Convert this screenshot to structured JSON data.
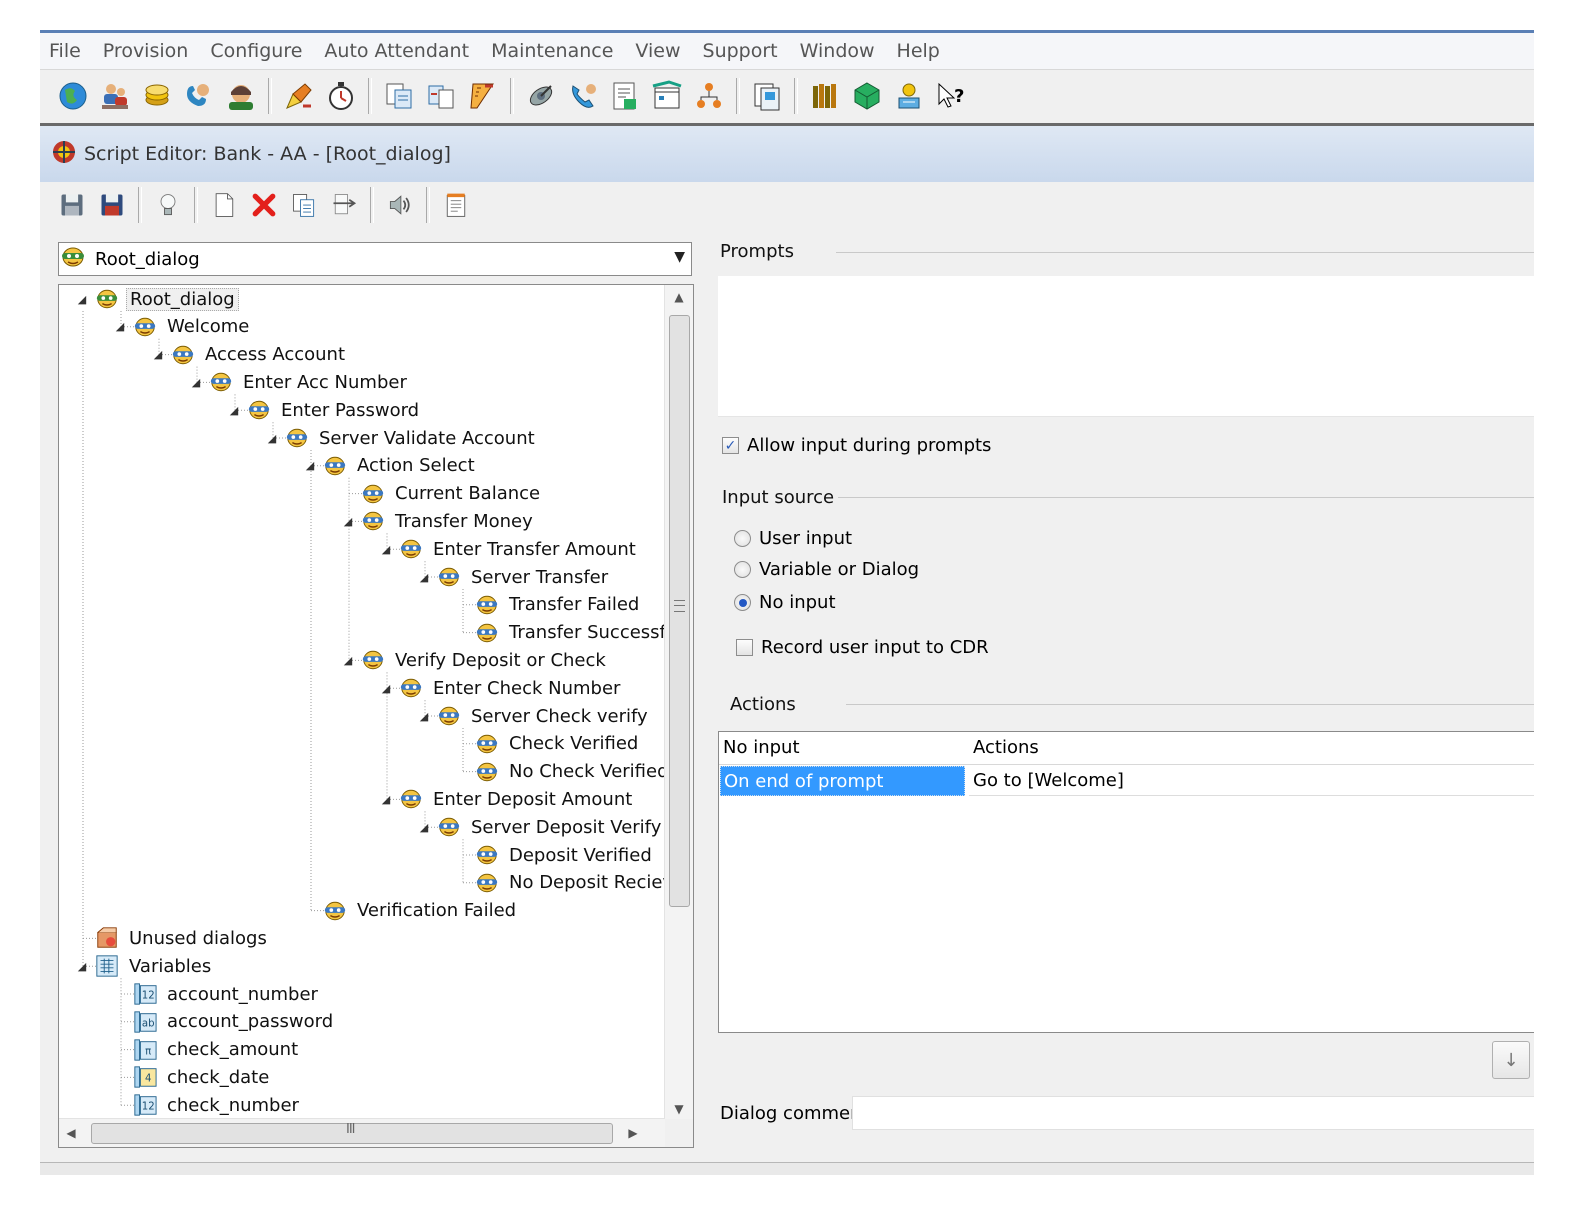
{
  "menu": [
    "File",
    "Provision",
    "Configure",
    "Auto Attendant",
    "Maintenance",
    "View",
    "Support",
    "Window",
    "Help"
  ],
  "main_toolbar_icons": [
    "globe-icon",
    "users-icon",
    "coins-icon",
    "phone-user-icon",
    "operator-icon",
    "sep",
    "pencil-tools-icon",
    "stopwatch-icon",
    "sep",
    "copy-docs-icon",
    "move-docs-icon",
    "ruler-icon",
    "sep",
    "satellite-icon",
    "phone-handset-icon",
    "report-icon",
    "schedule-icon",
    "org-chart-icon",
    "sep",
    "windows-icon",
    "sep",
    "library-icon",
    "package-icon",
    "award-icon",
    "help-cursor-icon"
  ],
  "child_window": {
    "title": "Script Editor: Bank - AA - [Root_dialog]"
  },
  "editor_toolbar_icons": [
    "save-icon",
    "save-all-icon",
    "sep",
    "lightbulb-icon",
    "sep",
    "new-doc-icon",
    "delete-icon",
    "copy-icon",
    "cut-icon",
    "sep",
    "speaker-icon",
    "sep",
    "notepad-icon"
  ],
  "dialog_selector": {
    "value": "Root_dialog"
  },
  "tree": [
    {
      "label": "Root_dialog",
      "depth": 0,
      "icon": "dialog-root",
      "exp": "open",
      "selected": true
    },
    {
      "label": "Welcome",
      "depth": 1,
      "icon": "dialog",
      "exp": "open"
    },
    {
      "label": "Access Account",
      "depth": 2,
      "icon": "dialog",
      "exp": "open"
    },
    {
      "label": "Enter Acc Number",
      "depth": 3,
      "icon": "dialog",
      "exp": "open"
    },
    {
      "label": "Enter Password",
      "depth": 4,
      "icon": "dialog",
      "exp": "open"
    },
    {
      "label": "Server Validate Account",
      "depth": 5,
      "icon": "dialog",
      "exp": "open"
    },
    {
      "label": "Action Select",
      "depth": 6,
      "icon": "dialog",
      "exp": "open"
    },
    {
      "label": "Current Balance",
      "depth": 7,
      "icon": "dialog",
      "exp": "leaf"
    },
    {
      "label": "Transfer Money",
      "depth": 7,
      "icon": "dialog",
      "exp": "open"
    },
    {
      "label": "Enter Transfer Amount",
      "depth": 8,
      "icon": "dialog",
      "exp": "open"
    },
    {
      "label": "Server Transfer",
      "depth": 9,
      "icon": "dialog",
      "exp": "open"
    },
    {
      "label": "Transfer Failed",
      "depth": 10,
      "icon": "dialog",
      "exp": "leaf"
    },
    {
      "label": "Transfer Successf",
      "depth": 10,
      "icon": "dialog",
      "exp": "leaf"
    },
    {
      "label": "Verify Deposit or Check",
      "depth": 7,
      "icon": "dialog",
      "exp": "open"
    },
    {
      "label": "Enter Check Number",
      "depth": 8,
      "icon": "dialog",
      "exp": "open"
    },
    {
      "label": "Server Check verify",
      "depth": 9,
      "icon": "dialog",
      "exp": "open"
    },
    {
      "label": "Check Verified",
      "depth": 10,
      "icon": "dialog",
      "exp": "leaf"
    },
    {
      "label": "No Check Verified",
      "depth": 10,
      "icon": "dialog",
      "exp": "leaf"
    },
    {
      "label": "Enter Deposit Amount",
      "depth": 8,
      "icon": "dialog",
      "exp": "open"
    },
    {
      "label": "Server Deposit Verify",
      "depth": 9,
      "icon": "dialog",
      "exp": "open"
    },
    {
      "label": "Deposit Verified",
      "depth": 10,
      "icon": "dialog",
      "exp": "leaf"
    },
    {
      "label": "No Deposit Reciev",
      "depth": 10,
      "icon": "dialog",
      "exp": "leaf"
    },
    {
      "label": "Verification Failed",
      "depth": 6,
      "icon": "dialog",
      "exp": "leaf"
    },
    {
      "label": "Unused dialogs",
      "depth": 0,
      "icon": "unused",
      "exp": "leaf"
    },
    {
      "label": "Variables",
      "depth": 0,
      "icon": "variables",
      "exp": "open"
    },
    {
      "label": "account_number",
      "depth": 1,
      "icon": "var-num",
      "exp": "leaf",
      "badge": "12"
    },
    {
      "label": "account_password",
      "depth": 1,
      "icon": "var-text",
      "exp": "leaf",
      "badge": "ab"
    },
    {
      "label": "check_amount",
      "depth": 1,
      "icon": "var-pi",
      "exp": "leaf",
      "badge": "π"
    },
    {
      "label": "check_date",
      "depth": 1,
      "icon": "var-date",
      "exp": "leaf",
      "badge": "4"
    },
    {
      "label": "check_number",
      "depth": 1,
      "icon": "var-num",
      "exp": "leaf",
      "badge": "12"
    }
  ],
  "tree_hscroll_grip": "III",
  "right": {
    "prompts_label": "Prompts",
    "allow_input_label": "Allow input during prompts",
    "allow_input_checked": true,
    "input_source_label": "Input source",
    "input_options": [
      {
        "label": "User input",
        "selected": false
      },
      {
        "label": "Variable or Dialog",
        "selected": false
      },
      {
        "label": "No input",
        "selected": true
      }
    ],
    "record_cdr_label": "Record user input to CDR",
    "record_cdr_checked": false,
    "actions_label": "Actions",
    "table": {
      "headers": [
        "No input",
        "Actions"
      ],
      "rows": [
        {
          "trigger": "On end of prompt",
          "action": "Go to [Welcome]"
        }
      ]
    },
    "dialog_comment_label": "Dialog comment",
    "dialog_comment_value": ""
  },
  "colors": {
    "selection": "#3399ff",
    "title_bar": "#c9d8ec",
    "window_border": "#5a7fb5"
  }
}
